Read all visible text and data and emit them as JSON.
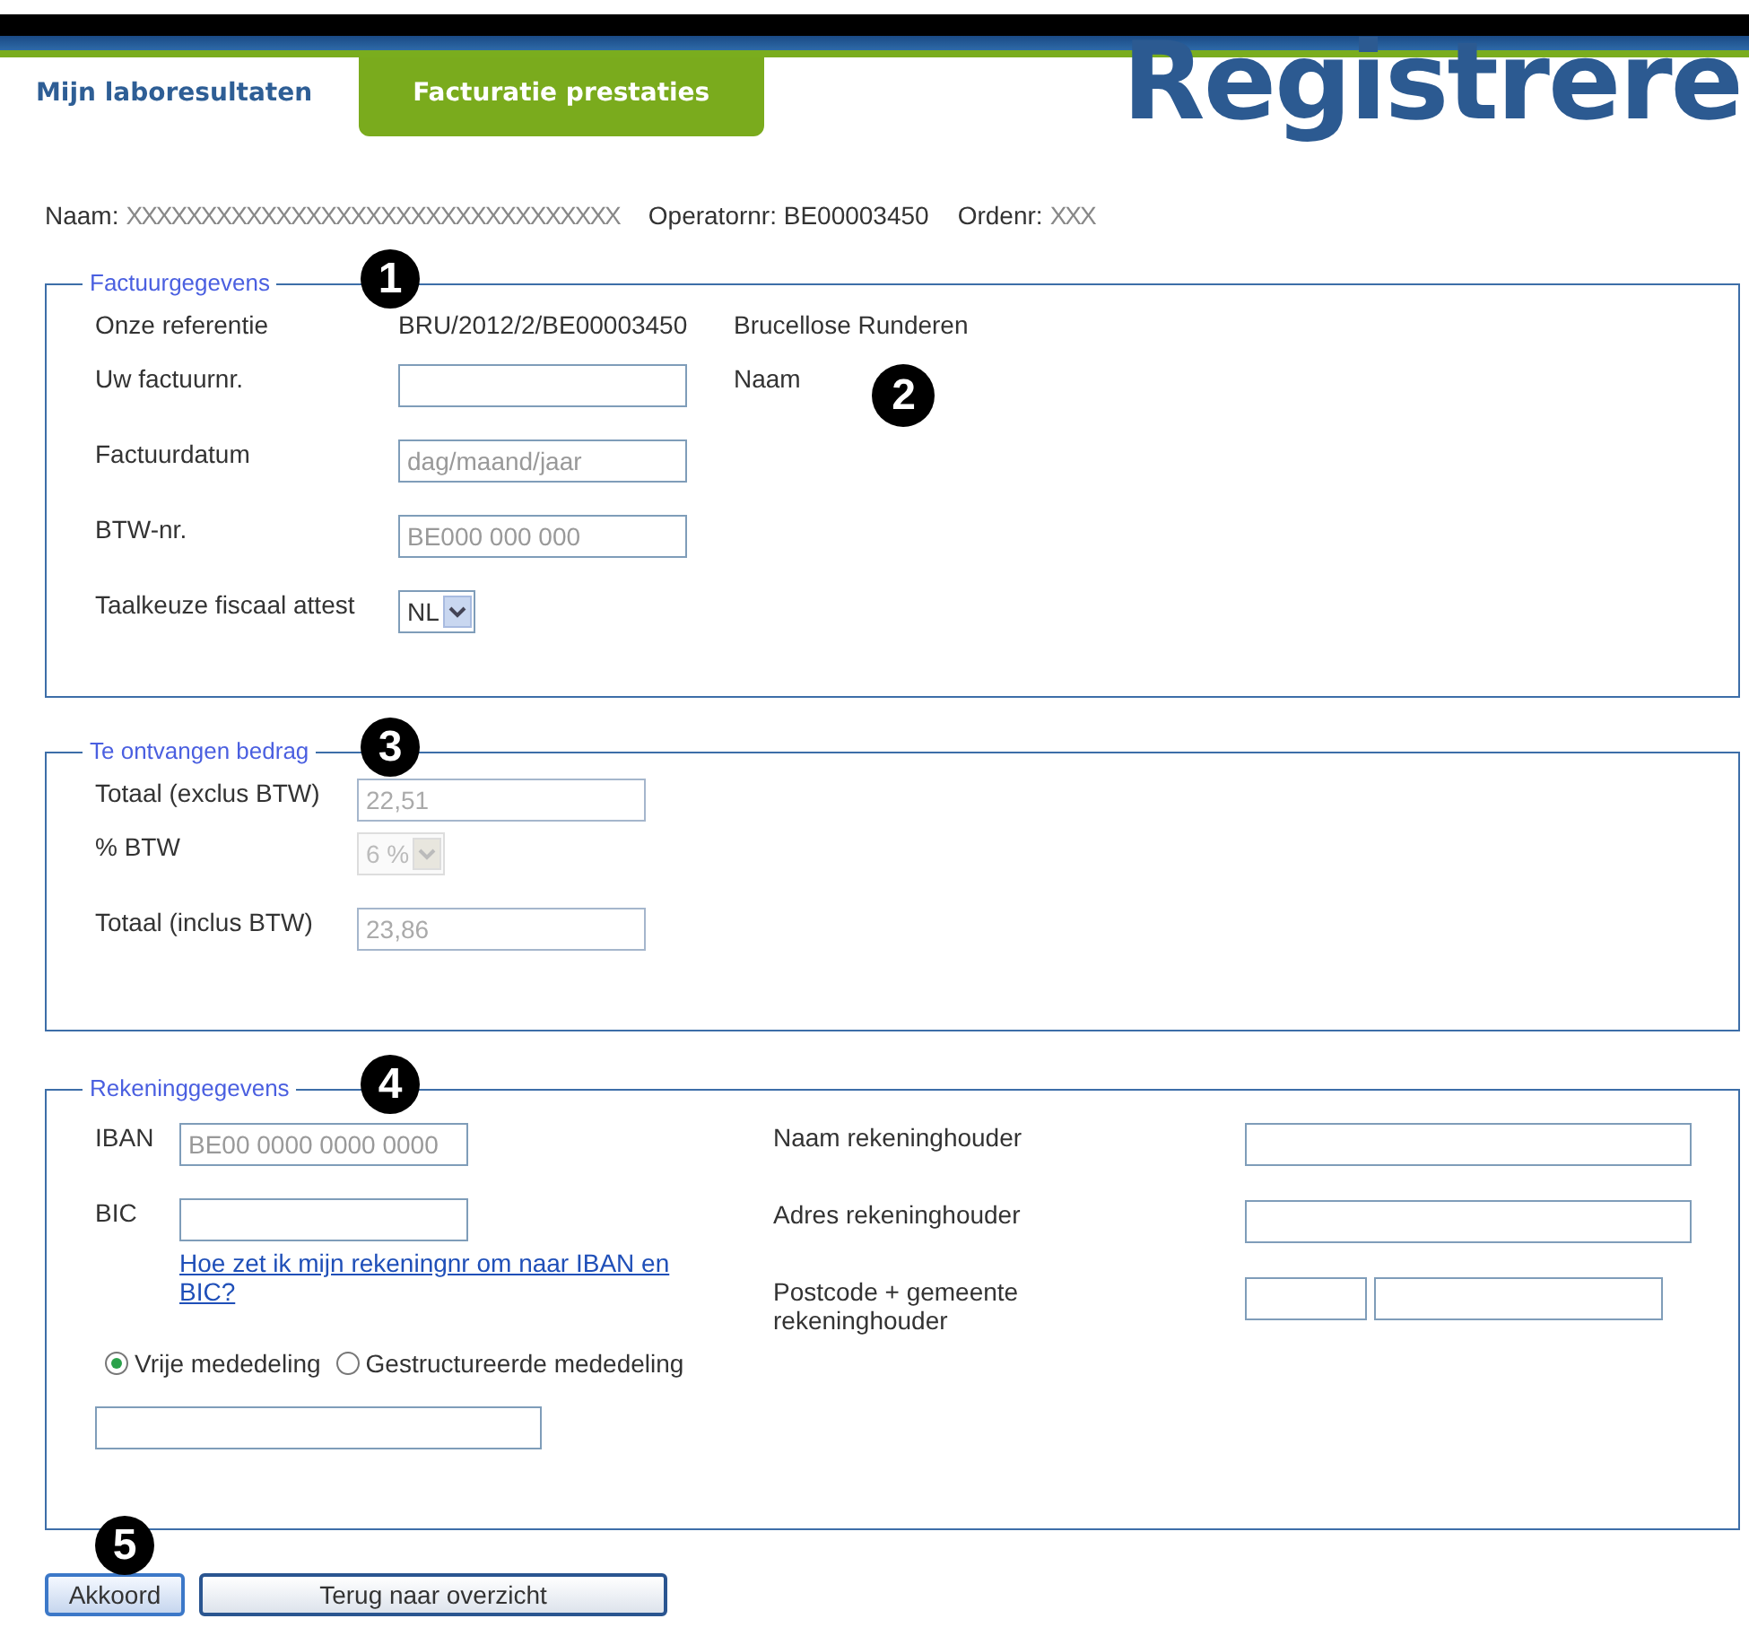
{
  "tabs": [
    {
      "label": "Mijn laboresultaten",
      "selected": false
    },
    {
      "label": "Facturatie prestaties",
      "selected": true
    }
  ],
  "banner_title": "Registrere",
  "info_line": {
    "name_label": "Naam:",
    "name_redacted": "XXXXXXXXXXXXXXXXXXXXXXXXXXXXXXXXX",
    "operator": "Operatornr: BE00003450",
    "order_label": "Ordenr:",
    "order_redacted": "XXX"
  },
  "invoice": {
    "legend": "Factuurgegevens",
    "callout": "1",
    "side_callout": "2",
    "rows": [
      {
        "kind": "text",
        "label": "Onze referentie",
        "value": "BRU/2012/2/BE00003450",
        "extra": "Brucellose Runderen"
      },
      {
        "kind": "input",
        "label": "Uw factuurnr.",
        "side_label": "Naam"
      },
      {
        "kind": "input",
        "label": "Factuurdatum",
        "placeholder": "dag/maand/jaar"
      },
      {
        "kind": "input",
        "label": "BTW-nr.",
        "placeholder": "BE000 000 000"
      },
      {
        "kind": "select",
        "label": "Taalkeuze fiscaal attest",
        "value": "NL",
        "disabled": false
      }
    ]
  },
  "amount": {
    "legend": "Te ontvangen bedrag",
    "callout": "3",
    "rows": [
      {
        "kind": "input",
        "label": "Totaal (exclus BTW)",
        "value": "22,51",
        "disabled": true
      },
      {
        "kind": "select",
        "label": "% BTW",
        "value": "6 %",
        "disabled": true
      },
      {
        "kind": "input",
        "label": "Totaal (inclus BTW)",
        "value": "23,86",
        "disabled": true
      }
    ]
  },
  "account": {
    "legend": "Rekeninggegevens",
    "callout": "4",
    "iban": {
      "label": "IBAN",
      "placeholder": "BE00 0000 0000 0000"
    },
    "bic": {
      "label": "BIC"
    },
    "help_link": "Hoe zet ik mijn rekeningnr om naar IBAN en BIC?",
    "holder_name": {
      "label": "Naam rekeninghouder"
    },
    "holder_address": {
      "label": "Adres rekeninghouder"
    },
    "holder_city": {
      "label": "Postcode + gemeente rekeninghouder"
    },
    "radios": [
      {
        "label": "Vrije mededeling",
        "selected": true
      },
      {
        "label": "Gestructureerde mededeling",
        "selected": false
      }
    ]
  },
  "buttons_callout": "5",
  "buttons": [
    {
      "label": "Akkoord",
      "kind": "primary"
    },
    {
      "label": "Terug naar overzicht",
      "kind": "secondary"
    }
  ]
}
